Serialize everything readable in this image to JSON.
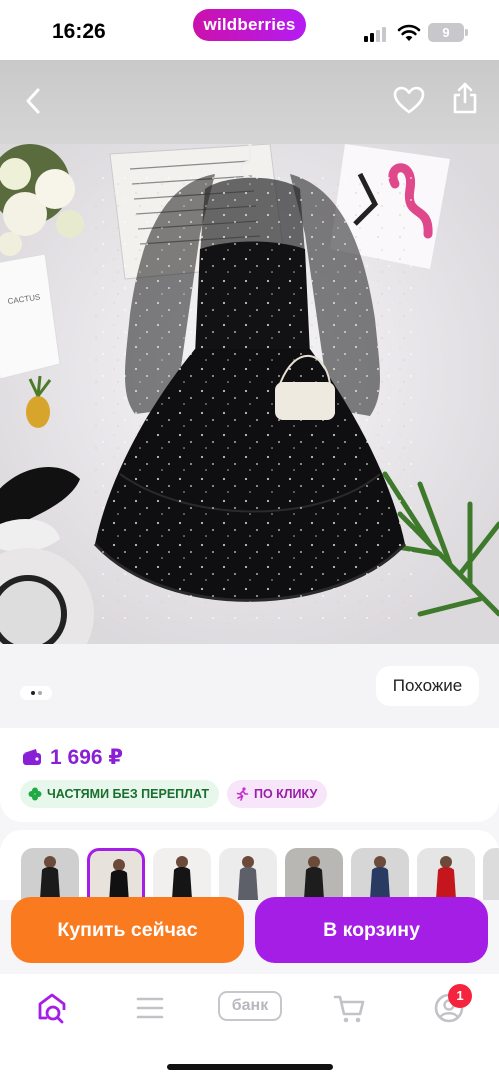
{
  "status_bar": {
    "time": "16:26",
    "battery": "9",
    "logo": "wildberries"
  },
  "header": {
    "back_icon": "chevron-left-icon",
    "favorite_icon": "heart-icon",
    "share_icon": "share-icon"
  },
  "product_photo": {
    "wall_card_text": "CACTUS"
  },
  "gallery": {
    "similar_label": "Похожие",
    "slide_count": 2,
    "active_slide": 1
  },
  "price": {
    "value": "1 696 ₽",
    "wallet_icon": "wallet-icon"
  },
  "chips": [
    {
      "label": "ЧАСТЯМИ БЕЗ ПЕРЕПЛАТ",
      "icon": "clover-icon",
      "color": "#1a6e2e"
    },
    {
      "label": "ПО КЛИКУ",
      "icon": "running-icon",
      "color": "#9a1ea8"
    }
  ],
  "variants": [
    {
      "color": "#1b1b1b",
      "bg": "#cfcfcf",
      "selected": false
    },
    {
      "color": "#111111",
      "bg": "#e8e2dc",
      "selected": true
    },
    {
      "color": "#151515",
      "bg": "#f2f0ee",
      "selected": false
    },
    {
      "color": "#5d6068",
      "bg": "#ececec",
      "selected": false
    },
    {
      "color": "#1d1d1d",
      "bg": "#b9b7b4",
      "selected": false
    },
    {
      "color": "#2a3b63",
      "bg": "#d6d6d6",
      "selected": false
    },
    {
      "color": "#c4161c",
      "bg": "#e5e5e5",
      "selected": false
    },
    {
      "color": "#1f4d36",
      "bg": "#dcdcdc",
      "selected": false
    }
  ],
  "actions": {
    "buy_now": "Купить сейчас",
    "add_to_cart": "В корзину"
  },
  "nav": {
    "home_icon": "home-search-icon",
    "catalog_icon": "menu-icon",
    "bank_label": "банк",
    "cart_icon": "cart-icon",
    "profile_icon": "profile-icon",
    "profile_badge": "1"
  },
  "colors": {
    "accent": "#a51ee6",
    "buy": "#f97a1f",
    "price": "#8b1fd6",
    "badge": "#f4243e"
  }
}
